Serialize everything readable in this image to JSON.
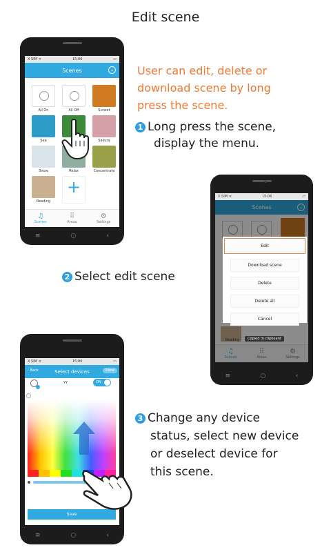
{
  "page_title": "Edit scene",
  "intro_note": {
    "line1": "User can edit, delete or",
    "line2": "download scene by long",
    "line3": "press the scene."
  },
  "steps": [
    {
      "num": "1",
      "line1": "Long press the scene,",
      "line2": "display the menu."
    },
    {
      "num": "2",
      "line1": "Select  edit scene"
    },
    {
      "num": "3",
      "line1": "Change any device",
      "line2": "status, select new device",
      "line3": "or deselect device for",
      "line4": "this scene."
    }
  ],
  "phone1": {
    "status_left": "X SIM ᯤ",
    "status_time": "15:06",
    "title": "Scenes",
    "scenes": [
      {
        "label": "All On",
        "kind": "bulb"
      },
      {
        "label": "All Off",
        "kind": "bulb"
      },
      {
        "label": "Sunset",
        "color": "#d07a22"
      },
      {
        "label": "Sea",
        "color": "#2c9cc8"
      },
      {
        "label": "Be",
        "color": "#3d8a3a"
      },
      {
        "label": "Sakura",
        "color": "#d6a0a8"
      },
      {
        "label": "Snow",
        "color": "#d8e4ea"
      },
      {
        "label": "Relax",
        "color": "#8fb0a0"
      },
      {
        "label": "Concentrate",
        "color": "#9aa04a"
      },
      {
        "label": "Reading",
        "color": "#c8b090"
      }
    ],
    "add_label": "+",
    "tabs": [
      {
        "label": "Scenes",
        "icon": "music-note-icon",
        "glyph": "♫",
        "active": true
      },
      {
        "label": "Areas",
        "icon": "grid-icon",
        "glyph": "⠿",
        "active": false
      },
      {
        "label": "Settings",
        "icon": "gear-icon",
        "glyph": "⚙",
        "active": false
      }
    ]
  },
  "phone2": {
    "status_left": "X SIM ᯤ",
    "status_time": "15:06",
    "title": "Scenes",
    "menu": [
      "Edit",
      "Download scene",
      "Delete",
      "Delete all",
      "Cancel"
    ],
    "background_scene": "Reading",
    "toast": "Copied to clipboard",
    "tabs": [
      "Scenes",
      "Areas",
      "Settings"
    ]
  },
  "phone3": {
    "status_left": "X SIM ᯤ",
    "status_time": "15:06",
    "back_label": "Back",
    "title": "Select devices",
    "done_label": "Done",
    "device_name": "YY",
    "toggle_label": "ON",
    "save_label": "Save"
  },
  "nav_keys": {
    "menu": "≡",
    "home": "○",
    "back": "‹"
  },
  "colors": {
    "accent": "#31a9e1",
    "note": "#f07a34",
    "step_badge": "#2f9fe0"
  }
}
